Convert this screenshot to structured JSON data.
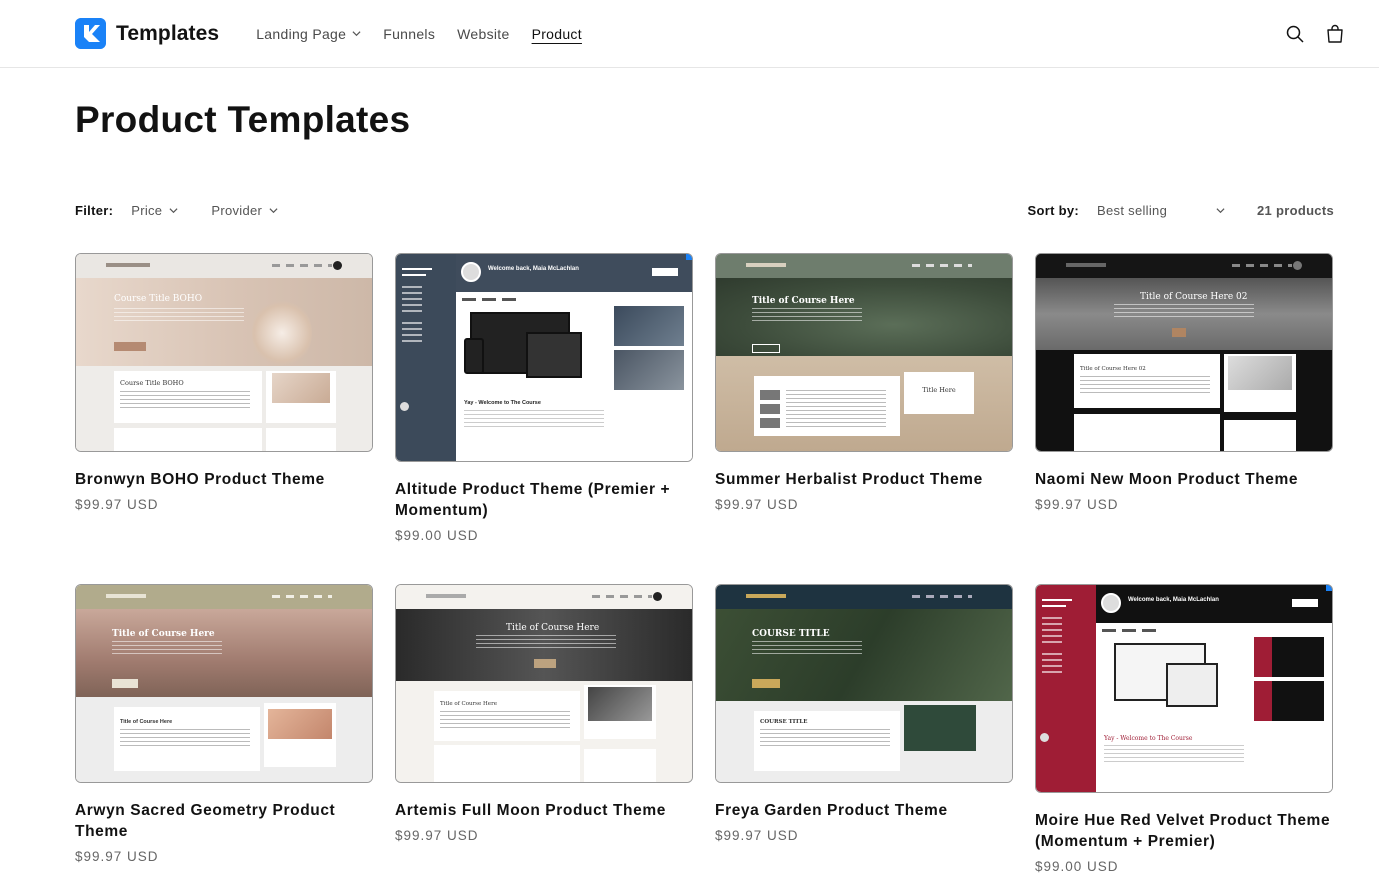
{
  "header": {
    "brand": "Templates",
    "nav": [
      {
        "label": "Landing Page",
        "has_dropdown": true,
        "active": false
      },
      {
        "label": "Funnels",
        "has_dropdown": false,
        "active": false
      },
      {
        "label": "Website",
        "has_dropdown": false,
        "active": false
      },
      {
        "label": "Product",
        "has_dropdown": false,
        "active": true
      }
    ],
    "icons": [
      "search-icon",
      "cart-icon"
    ]
  },
  "page_title": "Product Templates",
  "filters": {
    "label": "Filter:",
    "options": [
      "Price",
      "Provider"
    ],
    "sort_label": "Sort by:",
    "sort_value": "Best selling",
    "count": "21 products"
  },
  "products": [
    {
      "title": "Bronwyn BOHO Product Theme",
      "price": "$99.97 USD",
      "hero_text": "Course Title BOHO",
      "card_text": "Course Title BOHO"
    },
    {
      "title": "Altitude Product Theme (Premier + Momentum)",
      "price": "$99.00 USD",
      "hero_text": "Welcome back, Maia McLachlan",
      "card_text": "Yay - Welcome to The Course"
    },
    {
      "title": "Summer Herbalist Product Theme",
      "price": "$99.97 USD",
      "hero_text": "Title of Course Here",
      "card_text": "Title Here"
    },
    {
      "title": "Naomi New Moon Product Theme",
      "price": "$99.97 USD",
      "hero_text": "Title of Course Here 02",
      "card_text": "Title of Course Here 02"
    },
    {
      "title": "Arwyn Sacred Geometry Product Theme",
      "price": "$99.97 USD",
      "hero_text": "Title of Course Here",
      "card_text": "Title of Course Here"
    },
    {
      "title": "Artemis Full Moon Product Theme",
      "price": "$99.97 USD",
      "hero_text": "Title of Course Here",
      "card_text": "Title of Course Here"
    },
    {
      "title": "Freya Garden Product Theme",
      "price": "$99.97 USD",
      "hero_text": "COURSE TITLE",
      "card_text": "COURSE TITLE"
    },
    {
      "title": "Moire Hue Red Velvet Product Theme (Momentum + Premier)",
      "price": "$99.00 USD",
      "hero_text": "Welcome back, Maia McLachlan",
      "card_text": "Yay - Welcome to The Course"
    }
  ],
  "colors": {
    "brand": "#1a82f7",
    "text": "#121212",
    "muted": "#666666"
  }
}
